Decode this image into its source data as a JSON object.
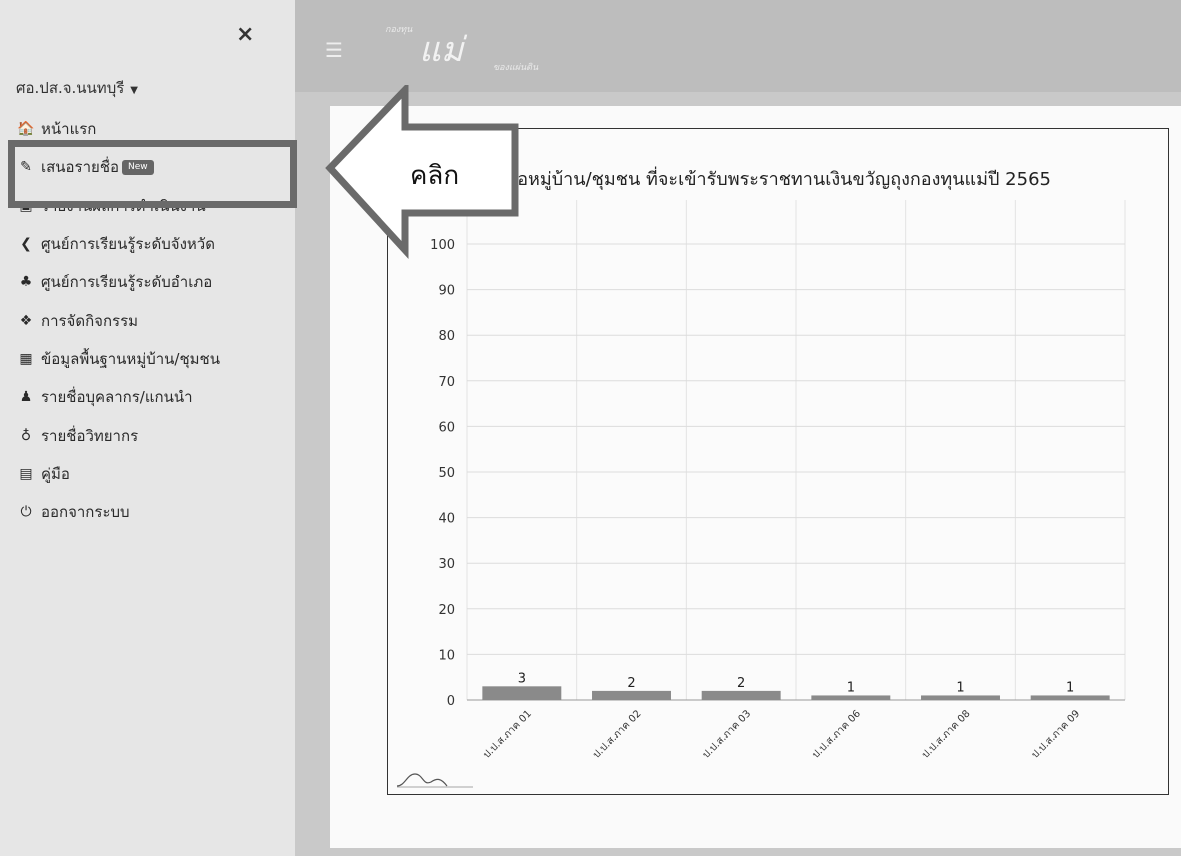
{
  "sidebar": {
    "close_symbol": "×",
    "user": "ศอ.ปส.จ.นนทบุรี",
    "items": [
      {
        "label": "หน้าแรก",
        "icon": "home-icon",
        "glyph": "🏠"
      },
      {
        "label": "เสนอรายชื่อ",
        "icon": "edit-icon",
        "glyph": "✎",
        "badge": "New"
      },
      {
        "label": "รายงานผลการดำเนินงาน",
        "icon": "report-icon",
        "glyph": "▣"
      },
      {
        "label": "ศูนย์การเรียนรู้ระดับจังหวัด",
        "icon": "share-icon",
        "glyph": "❮"
      },
      {
        "label": "ศูนย์การเรียนรู้ระดับอำเภอ",
        "icon": "sitemap-icon",
        "glyph": "♣"
      },
      {
        "label": "การจัดกิจกรรม",
        "icon": "activity-icon",
        "glyph": "❖"
      },
      {
        "label": "ข้อมูลพื้นฐานหมู่บ้าน/ชุมชน",
        "icon": "building-icon",
        "glyph": "▦"
      },
      {
        "label": "รายชื่อบุคลากร/แกนนำ",
        "icon": "user-plus-icon",
        "glyph": "♟"
      },
      {
        "label": "รายชื่อวิทยากร",
        "icon": "microphone-icon",
        "glyph": "♁"
      },
      {
        "label": "คู่มือ",
        "icon": "manual-icon",
        "glyph": "▤"
      },
      {
        "label": "ออกจากระบบ",
        "icon": "power-icon",
        "glyph": "⏻"
      }
    ]
  },
  "header": {
    "menu_icon": "hamburger-icon",
    "logo_small": "กองทุน",
    "logo_big": "แม่",
    "logo_sub": "ของแผ่นดิน"
  },
  "callout": {
    "label": "คลิก"
  },
  "colors": {
    "bar": "#8a8a8a",
    "highlight": "#6a6a6a"
  },
  "chart_data": {
    "type": "bar",
    "title": "รายชื่อหมู่บ้าน/ชุมชน ที่จะเข้ารับพระราชทานเงินขวัญถุงกองทุนแม่ปี 2565",
    "title_visible": "ชื่อหมู่บ้าน/ชุมชน ที่จะเข้ารับพระราชทานเงินขวัญถุงกองทุนแม่ปี 2565",
    "categories": [
      "ป.ป.ส.ภาค 01",
      "ป.ป.ส.ภาค 02",
      "ป.ป.ส.ภาค 03",
      "ป.ป.ส.ภาค 06",
      "ป.ป.ส.ภาค 08",
      "ป.ป.ส.ภาค 09"
    ],
    "values": [
      3,
      2,
      2,
      1,
      1,
      1
    ],
    "ylim": [
      0,
      100
    ],
    "yticks": [
      0,
      10,
      20,
      30,
      40,
      50,
      60,
      70,
      80,
      90,
      100
    ],
    "grid": true,
    "xlabel": "",
    "ylabel": ""
  }
}
